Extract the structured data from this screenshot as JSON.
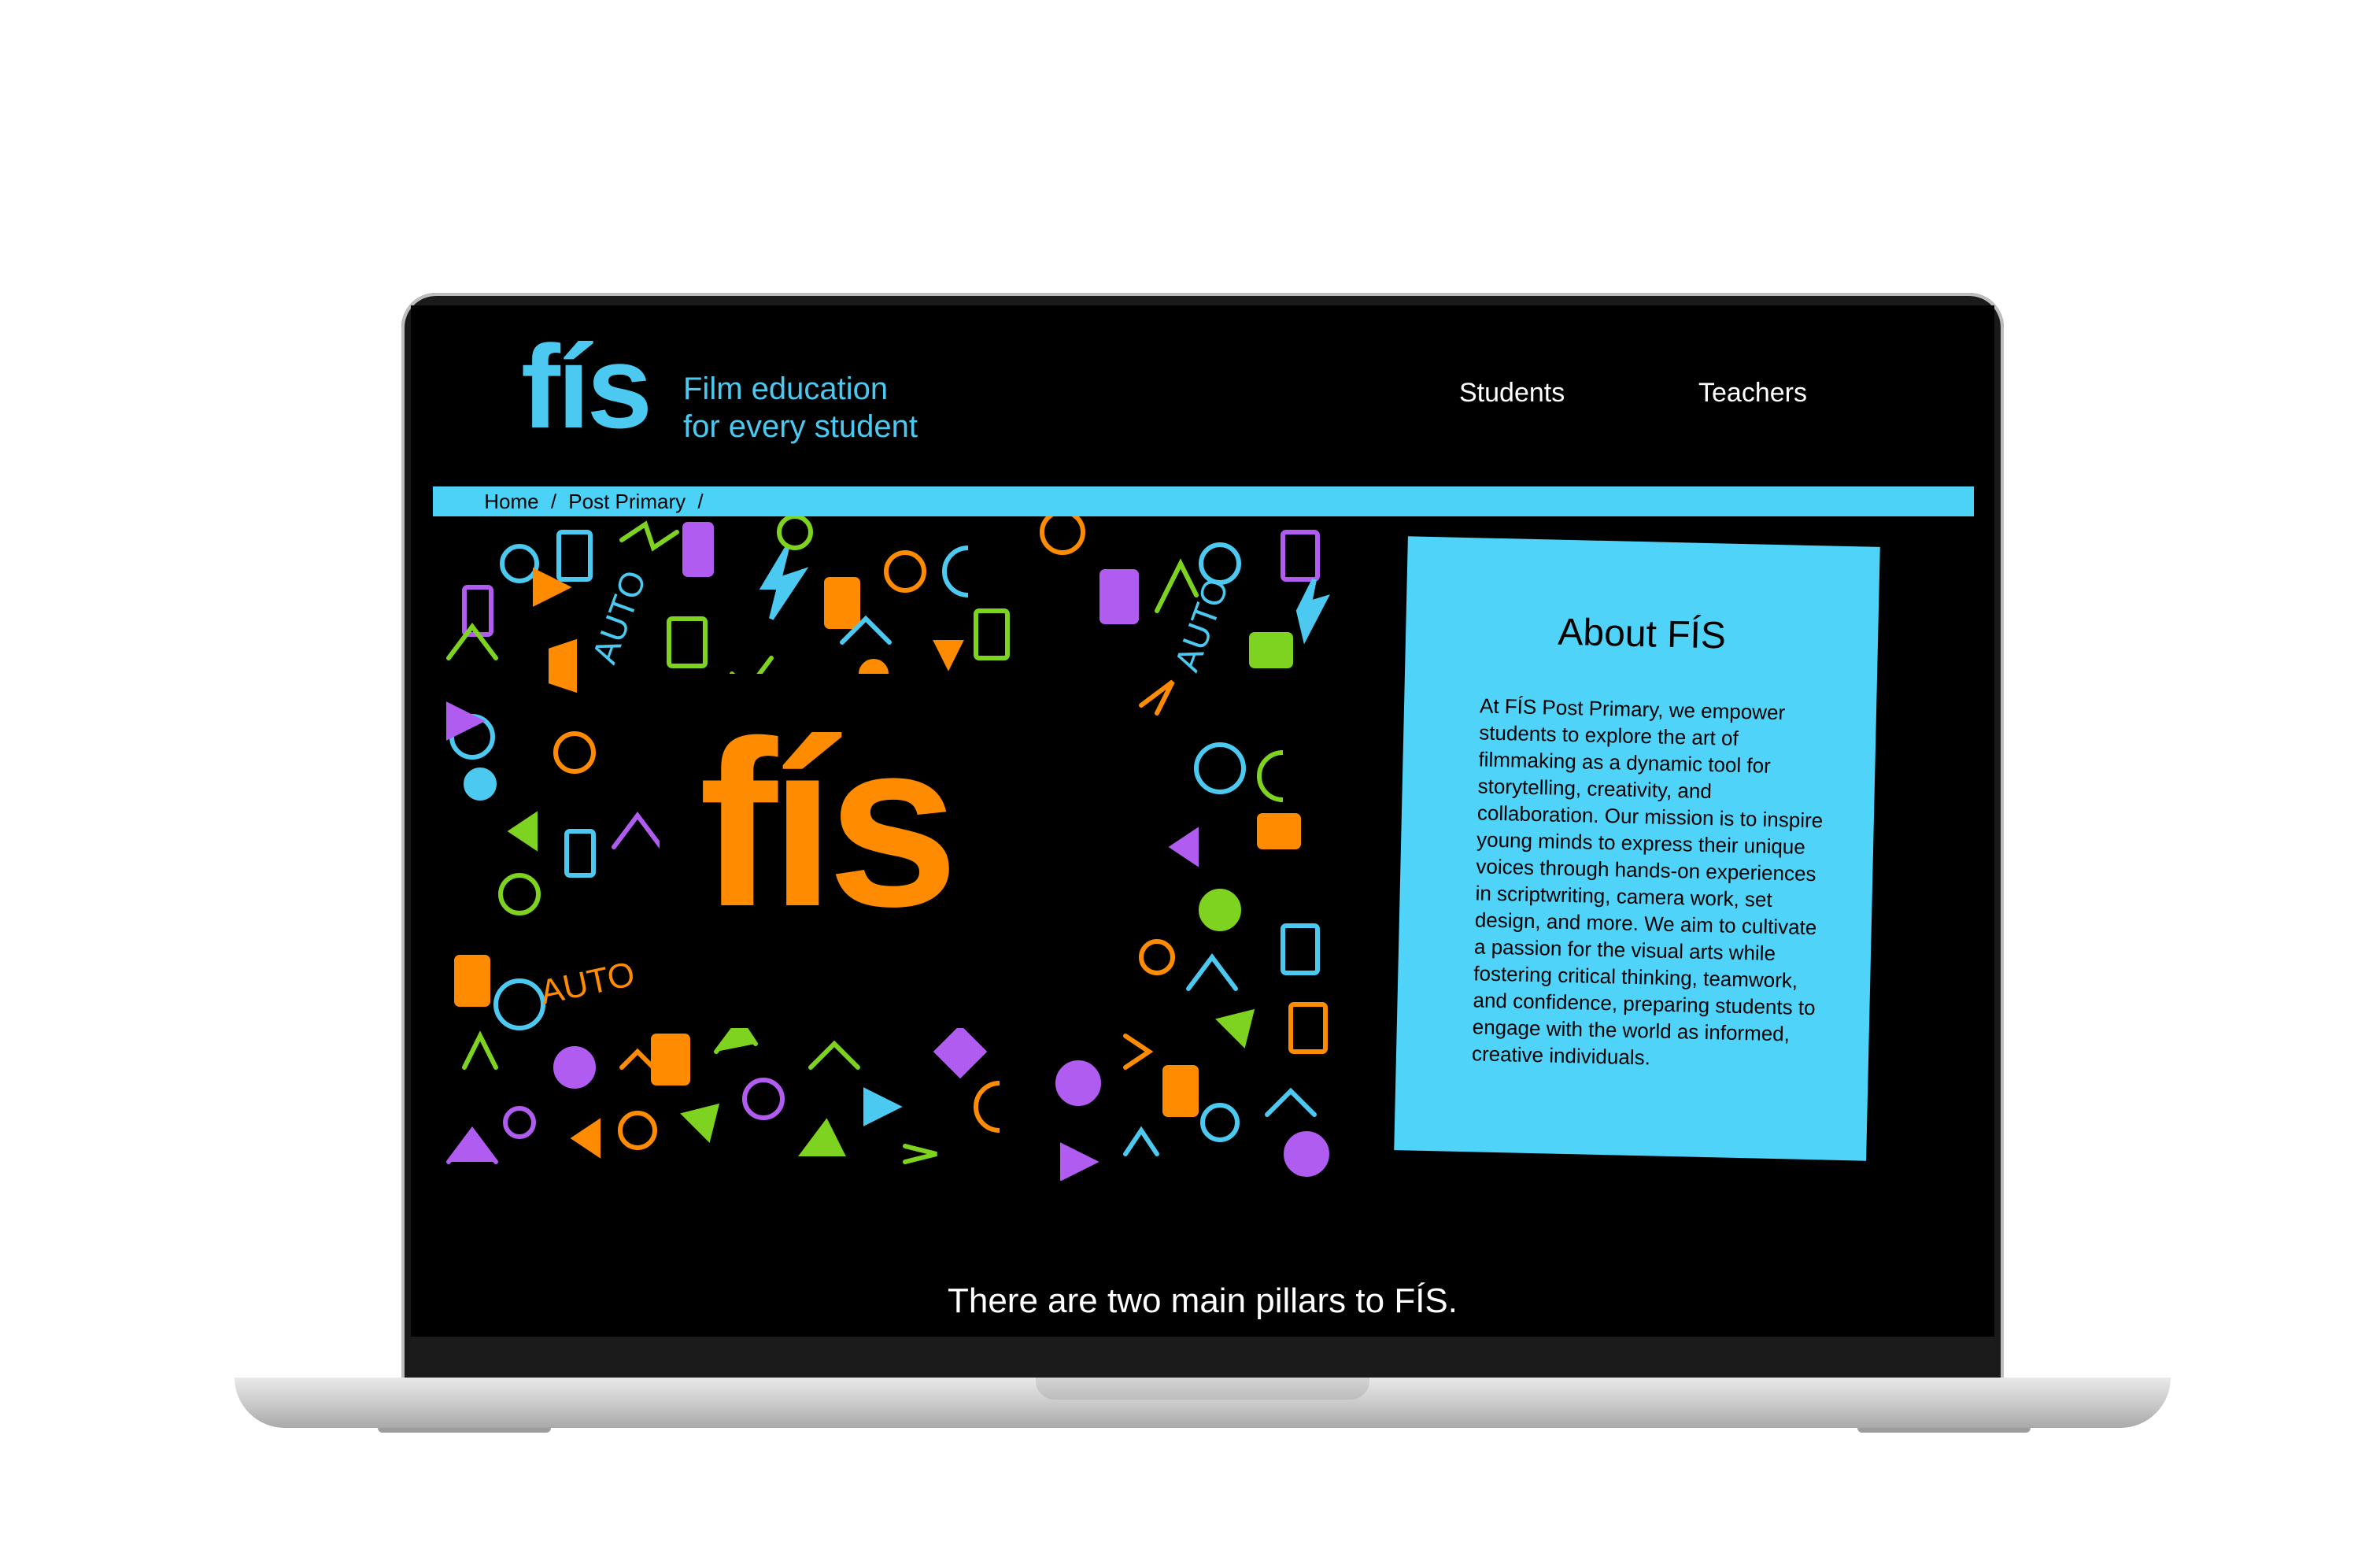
{
  "header": {
    "logo": "fís",
    "tagline_line1": "Film education",
    "tagline_line2": "for every student",
    "nav": [
      "Students",
      "Teachers"
    ]
  },
  "breadcrumb": {
    "items": [
      "Home",
      "Post Primary"
    ],
    "separator": "/"
  },
  "hero": {
    "logo": "fís",
    "logo_color": "#ff8c00",
    "pattern_colors": [
      "#4cc9f0",
      "#ff8c00",
      "#7ed321",
      "#b15cf0"
    ]
  },
  "about": {
    "title": "About FÍS",
    "body": "At FÍS Post Primary, we empower students to explore the art of filmmaking as a dynamic tool for storytelling, creativity, and collaboration. Our mission is to inspire young minds to express their unique voices through hands-on experiences in scriptwriting, camera work, set design, and more. We aim to cultivate a passion for the visual arts while fostering critical thinking, teamwork, and confidence, preparing students to engage with the world as informed, creative individuals."
  },
  "pillars_heading": "There are two main pillars to FÍS.",
  "colors": {
    "accent": "#4cc9f0",
    "panel": "#4fd3f9",
    "background": "#000000"
  }
}
